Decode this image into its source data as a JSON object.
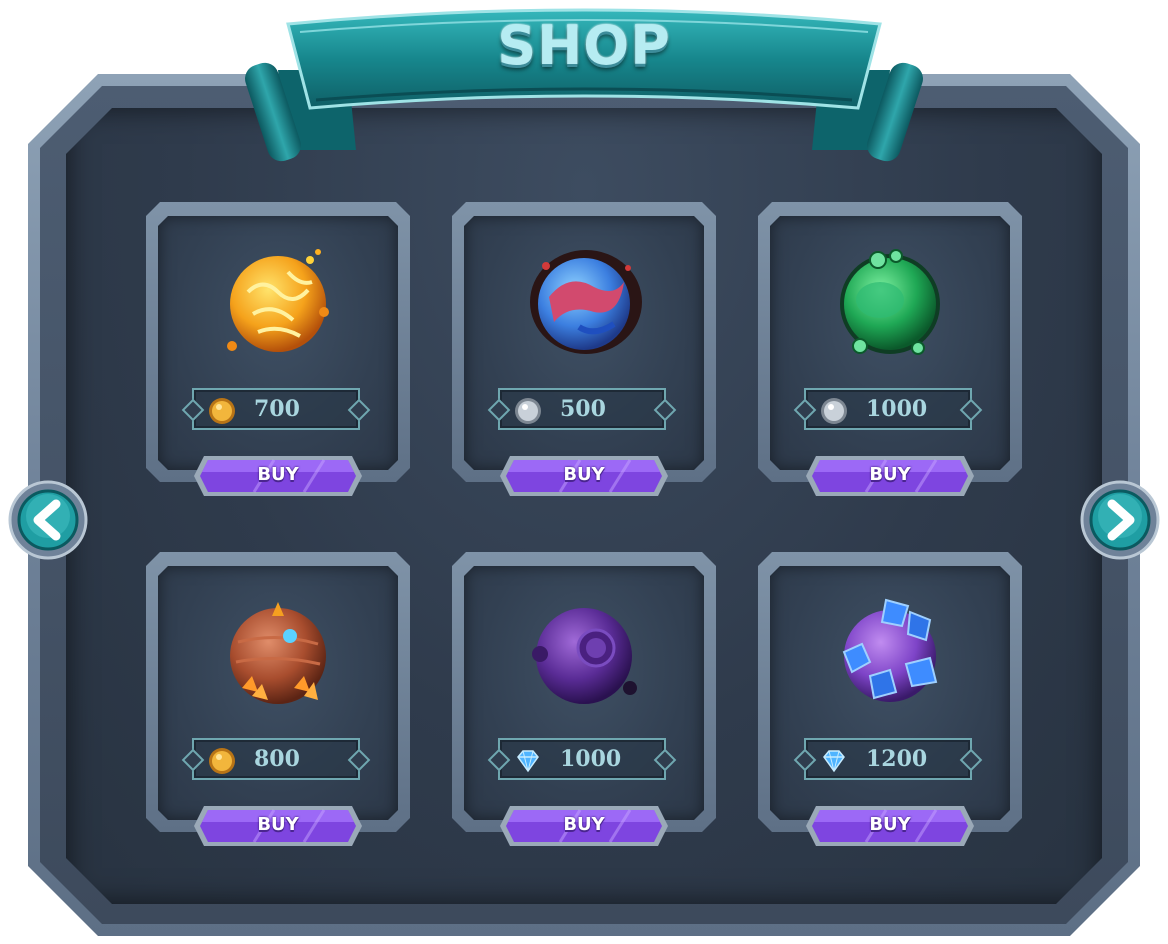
{
  "header": {
    "title": "SHOP"
  },
  "colors": {
    "ribbon": "#1a8f94",
    "panel_bg": "#2f3b4c",
    "buy_button": "#8a55e8",
    "price_text": "#a9d6df"
  },
  "nav": {
    "prev_icon": "chevron-left-icon",
    "next_icon": "chevron-right-icon"
  },
  "items": [
    {
      "art": "molten-gold-planet",
      "currency": "gold-coin",
      "price": "700",
      "buy_label": "BUY"
    },
    {
      "art": "blue-red-swirl-planet",
      "currency": "silver-coin",
      "price": "500",
      "buy_label": "BUY"
    },
    {
      "art": "green-slime-planet",
      "currency": "silver-coin",
      "price": "1000",
      "buy_label": "BUY"
    },
    {
      "art": "orange-crystal-planet",
      "currency": "gold-coin",
      "price": "800",
      "buy_label": "BUY"
    },
    {
      "art": "purple-crater-planet",
      "currency": "diamond",
      "price": "1000",
      "buy_label": "BUY"
    },
    {
      "art": "blue-crystal-purple-planet",
      "currency": "diamond",
      "price": "1200",
      "buy_label": "BUY"
    }
  ]
}
